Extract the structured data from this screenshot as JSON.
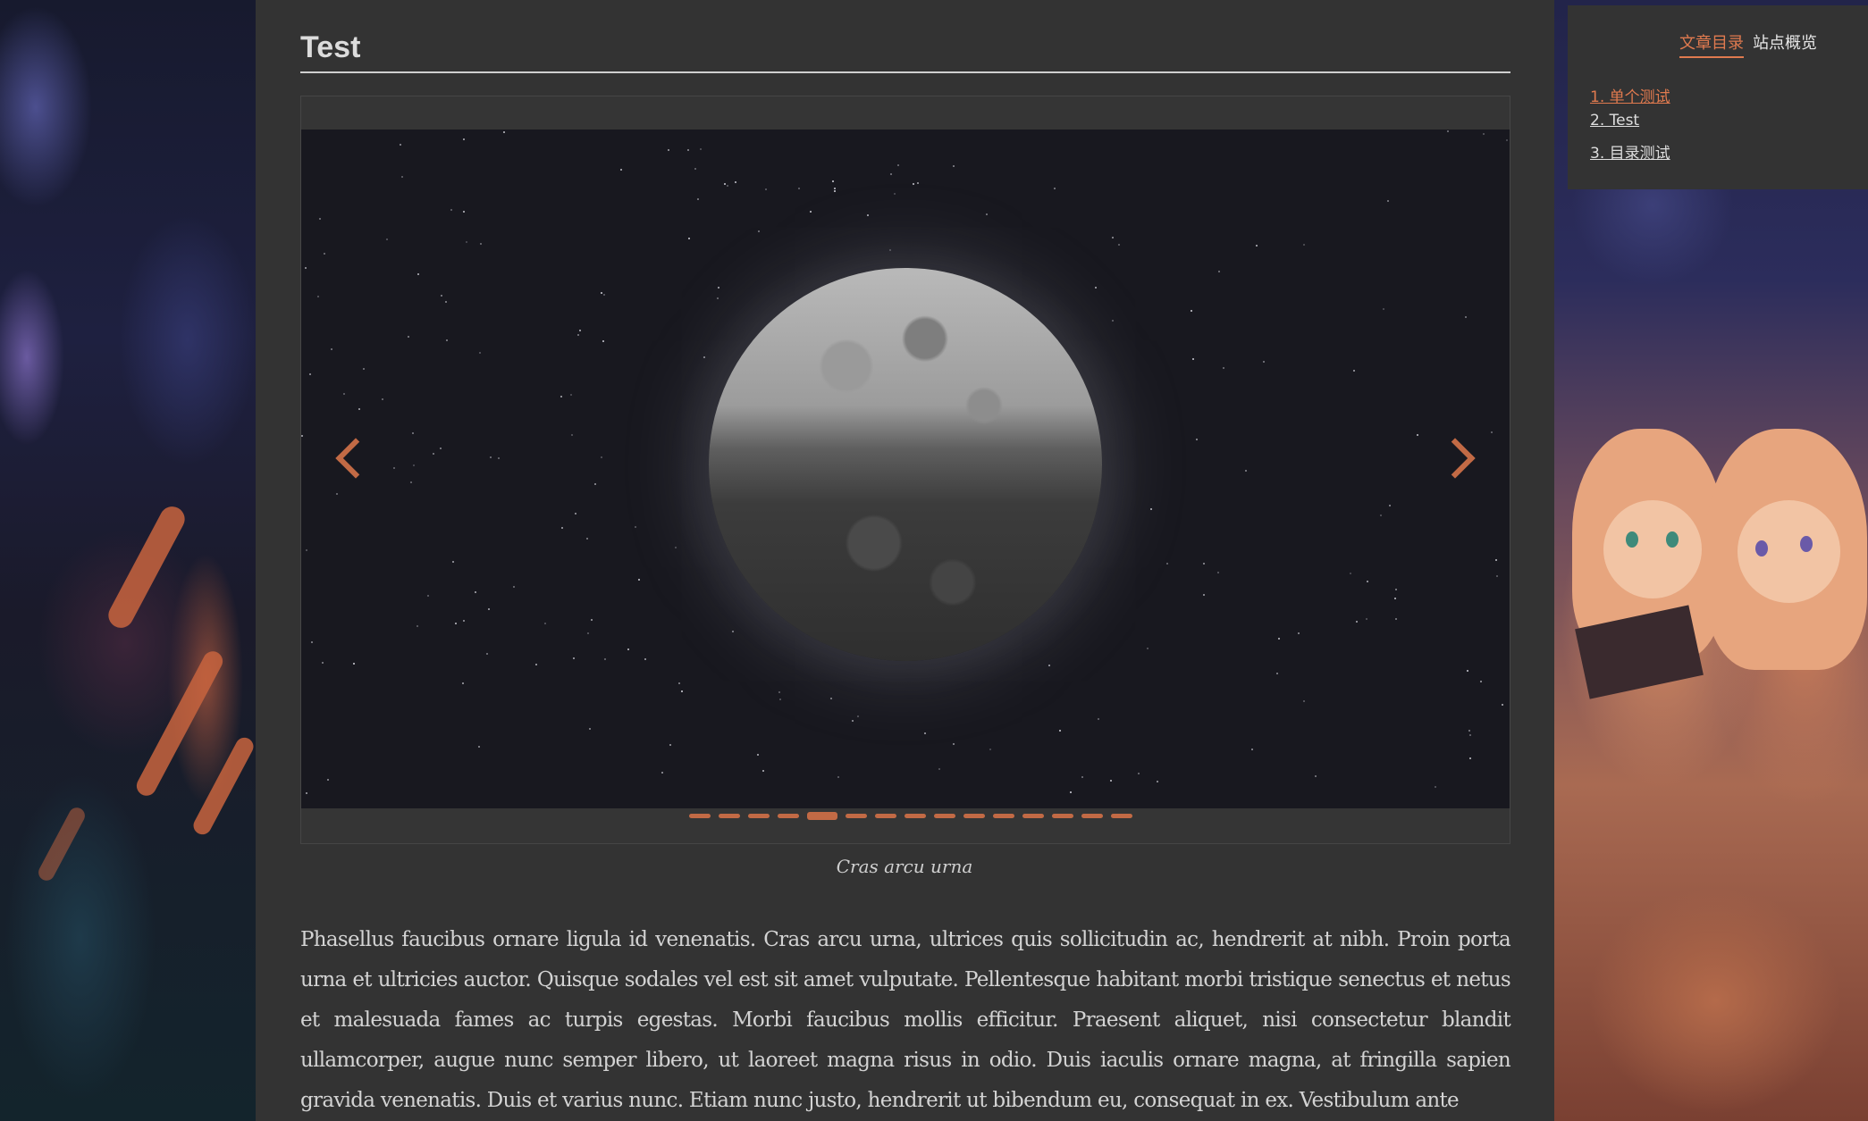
{
  "post": {
    "title": "Test"
  },
  "carousel": {
    "prev_label": "previous-slide",
    "next_label": "next-slide",
    "slide_count": 15,
    "active_index": 4,
    "accent_color": "#c26a45"
  },
  "caption": "Cras arcu urna",
  "body_text": "Phasellus faucibus ornare ligula id venenatis. Cras arcu urna, ultrices quis sollicitudin ac, hendrerit at nibh. Proin porta urna et ultricies auctor. Quisque sodales vel est sit amet vulputate. Pellentesque habitant morbi tristique senectus et netus et malesuada fames ac turpis egestas. Morbi faucibus mollis efficitur. Praesent aliquet, nisi consectetur blandit ullamcorper, augue nunc semper libero, ut laoreet magna risus in odio. Duis iaculis ornare magna, at fringilla sapien gravida venenatis. Duis et varius nunc. Etiam nunc justo, hendrerit ut bibendum eu, consequat in ex. Vestibulum ante",
  "sidebar": {
    "tabs": [
      {
        "label": "文章目录"
      },
      {
        "label": "站点概览"
      }
    ],
    "toc": [
      {
        "label": "1. 单个测试"
      },
      {
        "label": "2. Test"
      },
      {
        "label": "3. 目录测试"
      }
    ]
  }
}
